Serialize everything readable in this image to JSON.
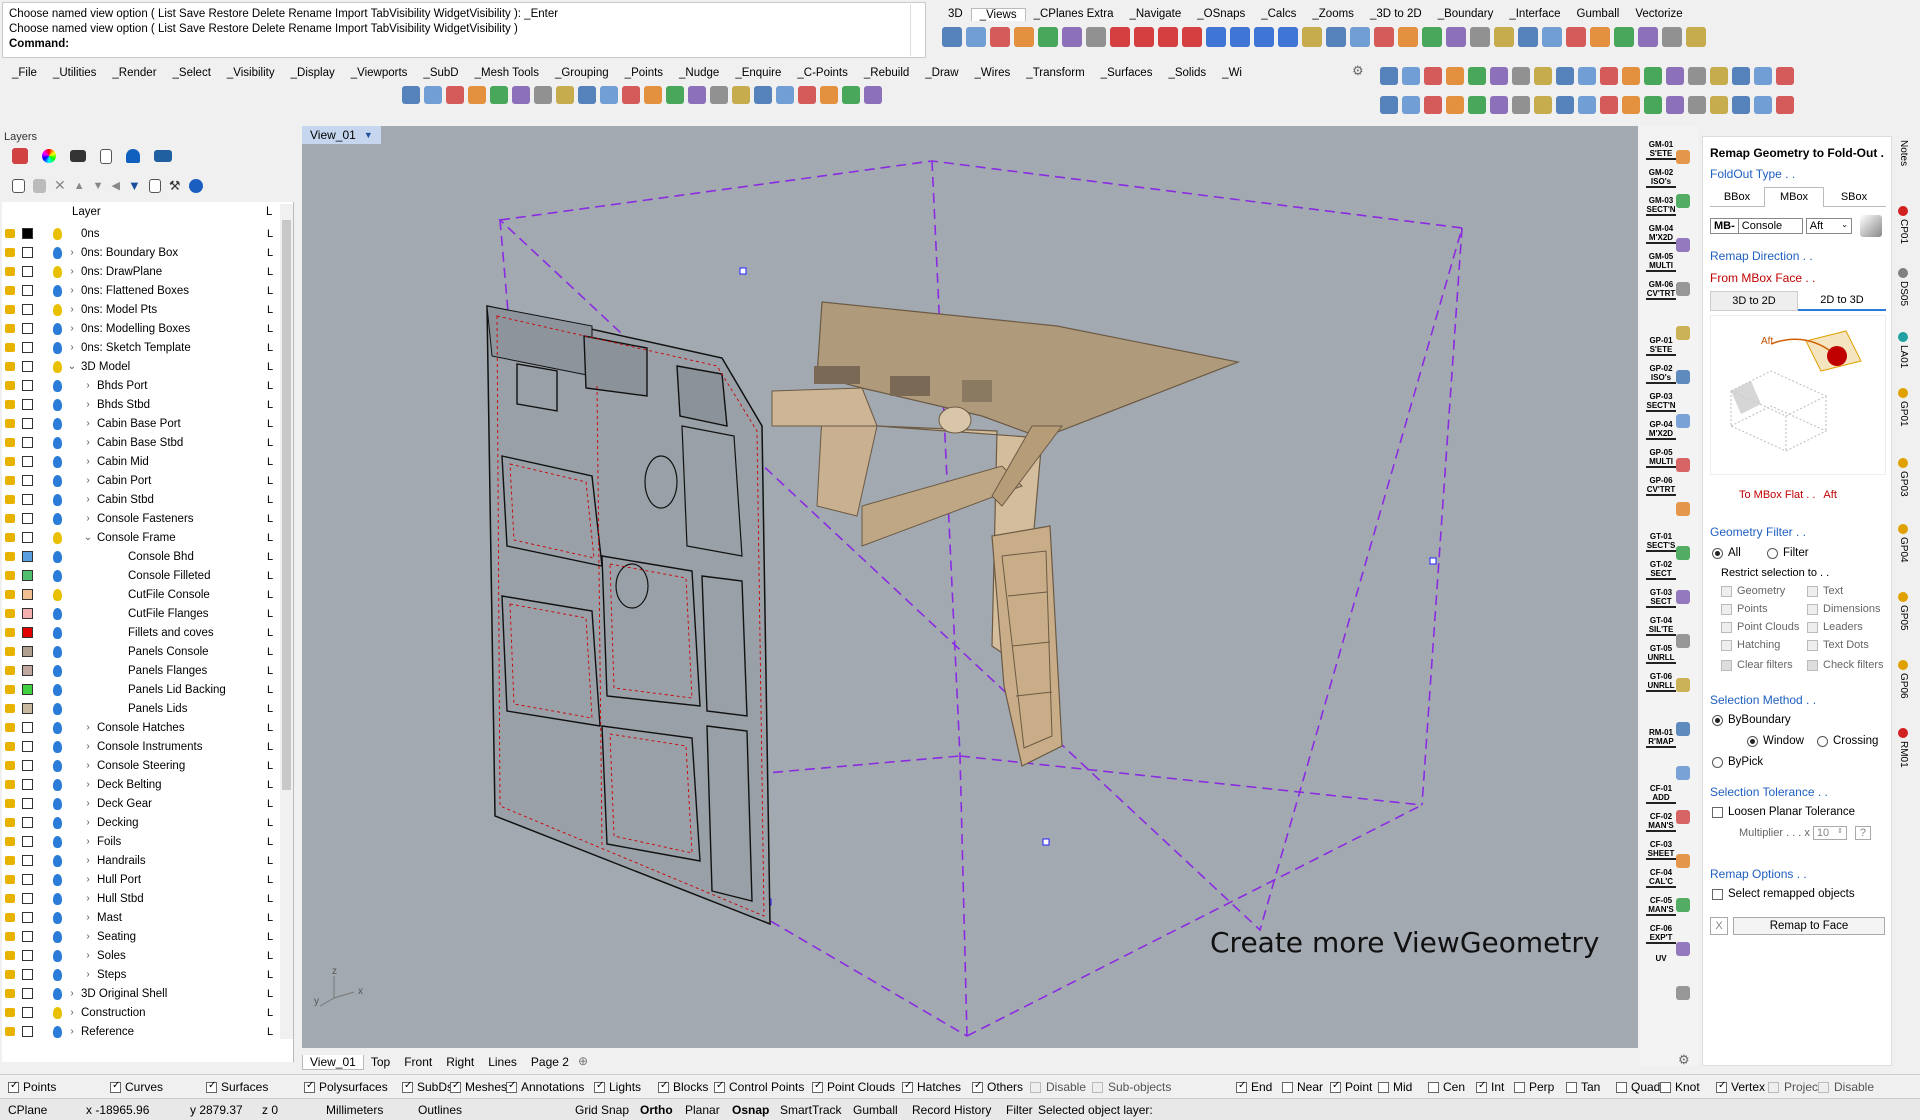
{
  "command": {
    "line1": "Choose named view option ( List  Save  Restore  Delete  Rename  Import  TabVisibility  WidgetVisibility ): _Enter",
    "line2": "Choose named view option ( List  Save  Restore  Delete  Rename  Import  TabVisibility  WidgetVisibility )",
    "prompt": "Command:"
  },
  "top_tabs": [
    "3D",
    "_Views",
    "_CPlanes Extra",
    "_Navigate",
    "_OSnaps",
    "_Calcs",
    "_Zooms",
    "_3D to 2D",
    "_Boundary",
    "_Interface",
    "Gumball",
    "Vectorize"
  ],
  "menu_tabs": [
    "_File",
    "_Utilities",
    "_Render",
    "_Select",
    "_Visibility",
    "_Display",
    "_Viewports",
    "_SubD",
    "_Mesh Tools",
    "_Grouping",
    "_Points",
    "_Nudge",
    "_Enquire",
    "_C-Points",
    "_Rebuild",
    "_Draw",
    "_Wires",
    "_Transform",
    "_Surfaces",
    "_Solids",
    "_Wi"
  ],
  "layers": {
    "panel_title": "Layers",
    "col_layer": "Layer",
    "col_m": "L",
    "rows": [
      {
        "name": "0ns",
        "indent": 0,
        "exp": "",
        "color": "#000000",
        "bulb": "#e8c000"
      },
      {
        "name": "0ns: Boundary Box",
        "indent": 0,
        "exp": "›",
        "color": "#ffffff",
        "bulb": "#2a7cd8"
      },
      {
        "name": "0ns: DrawPlane",
        "indent": 0,
        "exp": "›",
        "color": "#ffffff",
        "bulb": "#e8c000"
      },
      {
        "name": "0ns: Flattened Boxes",
        "indent": 0,
        "exp": "›",
        "color": "#ffffff",
        "bulb": "#2a7cd8"
      },
      {
        "name": "0ns: Model Pts",
        "indent": 0,
        "exp": "›",
        "color": "#ffffff",
        "bulb": "#e8c000"
      },
      {
        "name": "0ns: Modelling Boxes",
        "indent": 0,
        "exp": "›",
        "color": "#ffffff",
        "bulb": "#2a7cd8"
      },
      {
        "name": "0ns: Sketch Template",
        "indent": 0,
        "exp": "›",
        "color": "#ffffff",
        "bulb": "#2a7cd8"
      },
      {
        "name": "3D Model",
        "indent": 0,
        "exp": "⌄",
        "color": "#ffffff",
        "bulb": "#e8c000"
      },
      {
        "name": "Bhds Port",
        "indent": 1,
        "exp": "›",
        "color": "#ffffff",
        "bulb": "#2a7cd8"
      },
      {
        "name": "Bhds Stbd",
        "indent": 1,
        "exp": "›",
        "color": "#ffffff",
        "bulb": "#2a7cd8"
      },
      {
        "name": "Cabin Base Port",
        "indent": 1,
        "exp": "›",
        "color": "#ffffff",
        "bulb": "#2a7cd8"
      },
      {
        "name": "Cabin Base Stbd",
        "indent": 1,
        "exp": "›",
        "color": "#ffffff",
        "bulb": "#2a7cd8"
      },
      {
        "name": "Cabin Mid",
        "indent": 1,
        "exp": "›",
        "color": "#ffffff",
        "bulb": "#2a7cd8"
      },
      {
        "name": "Cabin Port",
        "indent": 1,
        "exp": "›",
        "color": "#ffffff",
        "bulb": "#2a7cd8"
      },
      {
        "name": "Cabin Stbd",
        "indent": 1,
        "exp": "›",
        "color": "#ffffff",
        "bulb": "#2a7cd8"
      },
      {
        "name": "Console Fasteners",
        "indent": 1,
        "exp": "›",
        "color": "#ffffff",
        "bulb": "#2a7cd8"
      },
      {
        "name": "Console Frame",
        "indent": 1,
        "exp": "⌄",
        "color": "#ffffff",
        "bulb": "#e8c000"
      },
      {
        "name": "Console Bhd",
        "indent": 2,
        "exp": "",
        "color": "#5aa0e0",
        "bulb": "#2a7cd8"
      },
      {
        "name": "Console Filleted",
        "indent": 2,
        "exp": "",
        "color": "#50c070",
        "bulb": "#2a7cd8"
      },
      {
        "name": "CutFile Console",
        "indent": 2,
        "exp": "",
        "color": "#f0c090",
        "bulb": "#e8c000"
      },
      {
        "name": "CutFile Flanges",
        "indent": 2,
        "exp": "",
        "color": "#f4b0b0",
        "bulb": "#2a7cd8"
      },
      {
        "name": "Fillets and coves",
        "indent": 2,
        "exp": "",
        "color": "#e00000",
        "bulb": "#2a7cd8"
      },
      {
        "name": "Panels Console",
        "indent": 2,
        "exp": "",
        "color": "#b0a090",
        "bulb": "#2a7cd8"
      },
      {
        "name": "Panels Flanges",
        "indent": 2,
        "exp": "",
        "color": "#c0a8a0",
        "bulb": "#2a7cd8"
      },
      {
        "name": "Panels Lid Backing",
        "indent": 2,
        "exp": "",
        "color": "#40d040",
        "bulb": "#2a7cd8"
      },
      {
        "name": "Panels Lids",
        "indent": 2,
        "exp": "",
        "color": "#c8b8a0",
        "bulb": "#2a7cd8"
      },
      {
        "name": "Console Hatches",
        "indent": 1,
        "exp": "›",
        "color": "#ffffff",
        "bulb": "#2a7cd8"
      },
      {
        "name": "Console Instruments",
        "indent": 1,
        "exp": "›",
        "color": "#ffffff",
        "bulb": "#2a7cd8"
      },
      {
        "name": "Console Steering",
        "indent": 1,
        "exp": "›",
        "color": "#ffffff",
        "bulb": "#2a7cd8"
      },
      {
        "name": "Deck Belting",
        "indent": 1,
        "exp": "›",
        "color": "#ffffff",
        "bulb": "#2a7cd8"
      },
      {
        "name": "Deck Gear",
        "indent": 1,
        "exp": "›",
        "color": "#ffffff",
        "bulb": "#2a7cd8"
      },
      {
        "name": "Decking",
        "indent": 1,
        "exp": "›",
        "color": "#ffffff",
        "bulb": "#2a7cd8"
      },
      {
        "name": "Foils",
        "indent": 1,
        "exp": "›",
        "color": "#ffffff",
        "bulb": "#2a7cd8"
      },
      {
        "name": "Handrails",
        "indent": 1,
        "exp": "›",
        "color": "#ffffff",
        "bulb": "#2a7cd8"
      },
      {
        "name": "Hull Port",
        "indent": 1,
        "exp": "›",
        "color": "#ffffff",
        "bulb": "#2a7cd8"
      },
      {
        "name": "Hull Stbd",
        "indent": 1,
        "exp": "›",
        "color": "#ffffff",
        "bulb": "#2a7cd8"
      },
      {
        "name": "Mast",
        "indent": 1,
        "exp": "›",
        "color": "#ffffff",
        "bulb": "#2a7cd8"
      },
      {
        "name": "Seating",
        "indent": 1,
        "exp": "›",
        "color": "#ffffff",
        "bulb": "#2a7cd8"
      },
      {
        "name": "Soles",
        "indent": 1,
        "exp": "›",
        "color": "#ffffff",
        "bulb": "#2a7cd8"
      },
      {
        "name": "Steps",
        "indent": 1,
        "exp": "›",
        "color": "#ffffff",
        "bulb": "#2a7cd8"
      },
      {
        "name": "3D Original Shell",
        "indent": 0,
        "exp": "›",
        "color": "#ffffff",
        "bulb": "#2a7cd8"
      },
      {
        "name": "Construction",
        "indent": 0,
        "exp": "›",
        "color": "#ffffff",
        "bulb": "#e8c000"
      },
      {
        "name": "Reference",
        "indent": 0,
        "exp": "›",
        "color": "#ffffff",
        "bulb": "#2a7cd8"
      }
    ]
  },
  "viewport": {
    "title": "View_01",
    "overlay_text": "Create more ViewGeometry",
    "axis_z": "z",
    "axis_y": "y",
    "axis_x": "x"
  },
  "view_tabs": [
    "View_01",
    "Top",
    "Front",
    "Right",
    "Lines",
    "Page 2"
  ],
  "side_buttons": [
    {
      "l1": "GM-01",
      "l2": "S'ETE"
    },
    {
      "l1": "GM-02",
      "l2": "ISO's"
    },
    {
      "l1": "GM-03",
      "l2": "SECT'N"
    },
    {
      "l1": "GM-04",
      "l2": "M'X2D"
    },
    {
      "l1": "GM-05",
      "l2": "MULTI"
    },
    {
      "l1": "GM-06",
      "l2": "CV'TRT"
    },
    {
      "l1": "GP-01",
      "l2": "S'ETE"
    },
    {
      "l1": "GP-02",
      "l2": "ISO's"
    },
    {
      "l1": "GP-03",
      "l2": "SECT'N"
    },
    {
      "l1": "GP-04",
      "l2": "M'X2D"
    },
    {
      "l1": "GP-05",
      "l2": "MULTI"
    },
    {
      "l1": "GP-06",
      "l2": "CV'TRT"
    },
    {
      "l1": "GT-01",
      "l2": "SECT'S"
    },
    {
      "l1": "GT-02",
      "l2": "SECT"
    },
    {
      "l1": "GT-03",
      "l2": "SECT"
    },
    {
      "l1": "GT-04",
      "l2": "SIL'TE"
    },
    {
      "l1": "GT-05",
      "l2": "UNRLL"
    },
    {
      "l1": "GT-06",
      "l2": "UNRLL"
    },
    {
      "l1": "RM-01",
      "l2": "R'MAP"
    },
    {
      "l1": "CF-01",
      "l2": "ADD"
    },
    {
      "l1": "CF-02",
      "l2": "MAN'S"
    },
    {
      "l1": "CF-03",
      "l2": "SHEET"
    },
    {
      "l1": "CF-04",
      "l2": "CAL'C"
    },
    {
      "l1": "CF-05",
      "l2": "MAN'S"
    },
    {
      "l1": "CF-06",
      "l2": "EXP'T"
    },
    {
      "l1": "UV",
      "l2": ""
    }
  ],
  "panel": {
    "title": "Remap Geometry to Fold-Out .",
    "foldout_label": "FoldOut Type . .",
    "box_tabs": [
      "BBox",
      "MBox",
      "SBox"
    ],
    "mb_prefix": "MB-",
    "mb_name": "Console",
    "mb_dir": "Aft",
    "remap_direction": "Remap Direction . .",
    "from_face": "From MBox Face . .",
    "dir_tabs": [
      "3D to 2D",
      "2D to 3D"
    ],
    "diagram_label": "Aft",
    "to_flat": "To MBox Flat . .",
    "to_flat_val": "Aft",
    "geometry_filter": "Geometry Filter . .",
    "filter_all": "All",
    "filter_filter": "Filter",
    "restrict": "Restrict selection to . .",
    "filters": [
      [
        "Geometry",
        "Text"
      ],
      [
        "Points",
        "Dimensions"
      ],
      [
        "Point Clouds",
        "Leaders"
      ],
      [
        "Hatching",
        "Text Dots"
      ],
      [
        "Clear filters",
        "Check filters"
      ]
    ],
    "selection_method": "Selection Method . .",
    "by_boundary": "ByBoundary",
    "window": "Window",
    "crossing": "Crossing",
    "by_pick": "ByPick",
    "selection_tolerance": "Selection Tolerance . .",
    "loosen": "Loosen Planar Tolerance",
    "multiplier": "Multiplier . . . x",
    "multiplier_val": "10",
    "remap_options": "Remap Options . .",
    "select_remapped": "Select remapped objects",
    "remap_button": "Remap to Face",
    "x_button": "X",
    "help": "?"
  },
  "vertical_tabs": [
    "Notes",
    "CP01",
    "DS05",
    "LA01",
    "GP01",
    "GP03",
    "GP04",
    "GP05",
    "GP06",
    "RM01"
  ],
  "filter_left": [
    {
      "l": "Points",
      "c": true
    },
    {
      "l": "Curves",
      "c": true
    },
    {
      "l": "Surfaces",
      "c": true
    },
    {
      "l": "Polysurfaces",
      "c": true
    },
    {
      "l": "SubDs",
      "c": true
    },
    {
      "l": "Meshes",
      "c": true
    },
    {
      "l": "Annotations",
      "c": true
    },
    {
      "l": "Lights",
      "c": true
    },
    {
      "l": "Blocks",
      "c": true
    },
    {
      "l": "Control Points",
      "c": true
    },
    {
      "l": "Point Clouds",
      "c": true
    },
    {
      "l": "Hatches",
      "c": true
    },
    {
      "l": "Others",
      "c": true
    },
    {
      "l": "Disable",
      "c": false
    },
    {
      "l": "Sub-objects",
      "c": false
    }
  ],
  "filter_right": [
    {
      "l": "End",
      "c": true
    },
    {
      "l": "Near",
      "c": false
    },
    {
      "l": "Point",
      "c": true
    },
    {
      "l": "Mid",
      "c": false
    },
    {
      "l": "Cen",
      "c": false
    },
    {
      "l": "Int",
      "c": true
    },
    {
      "l": "Perp",
      "c": false
    },
    {
      "l": "Tan",
      "c": false
    },
    {
      "l": "Quad",
      "c": false
    },
    {
      "l": "Knot",
      "c": false
    },
    {
      "l": "Vertex",
      "c": true
    },
    {
      "l": "Project",
      "c": false
    },
    {
      "l": "Disable",
      "c": false
    }
  ],
  "status": {
    "cplane": "CPlane",
    "x": "x -18965.96",
    "y": "y 2879.37",
    "z": "z 0",
    "units": "Millimeters",
    "layer": "Outlines",
    "grid": "Grid Snap",
    "ortho": "Ortho",
    "planar": "Planar",
    "osnap": "Osnap",
    "smarttrack": "SmartTrack",
    "gumball": "Gumball",
    "history": "Record History",
    "filter": "Filter",
    "message": "Selected object layer:"
  }
}
